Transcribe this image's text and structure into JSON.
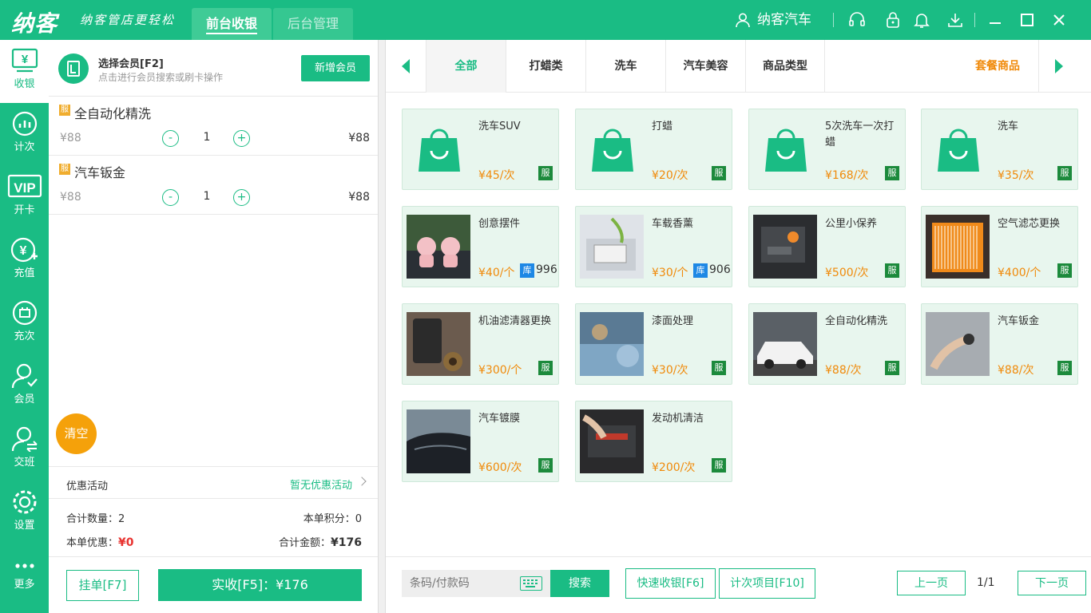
{
  "app": {
    "logo": "纳客",
    "slogan": "纳客管店更轻松",
    "nav_tabs": [
      {
        "label": "前台收银",
        "active": true
      },
      {
        "label": "后台管理",
        "active": false
      }
    ],
    "user_name": "纳客汽车",
    "accent_color": "#1abc84"
  },
  "sidebar": {
    "items": [
      {
        "label": "收银",
        "icon": "cashier-icon",
        "active": true
      },
      {
        "label": "计次",
        "icon": "chart-icon"
      },
      {
        "label": "开卡",
        "icon": "vip-icon"
      },
      {
        "label": "充值",
        "icon": "recharge-icon"
      },
      {
        "label": "充次",
        "icon": "recharge-count-icon"
      },
      {
        "label": "会员",
        "icon": "member-icon"
      },
      {
        "label": "交班",
        "icon": "shift-icon"
      },
      {
        "label": "设置",
        "icon": "settings-icon"
      },
      {
        "label": "更多",
        "icon": "more-icon"
      }
    ]
  },
  "member": {
    "title": "选择会员[F2]",
    "subtitle": "点击进行会员搜索或刷卡操作",
    "add_button": "新增会员"
  },
  "cart": {
    "items": [
      {
        "badge": "服",
        "name": "全自动化精洗",
        "price": "¥88",
        "minus": "-",
        "qty": "1",
        "plus": "+",
        "total": "¥88"
      },
      {
        "badge": "服",
        "name": "汽车钣金",
        "price": "¥88",
        "minus": "-",
        "qty": "1",
        "plus": "+",
        "total": "¥88"
      }
    ],
    "clear_button": "清空",
    "promo_label": "优惠活动",
    "promo_value": "暂无优惠活动",
    "qty_label": "合计数量：",
    "qty_value": "2",
    "points_label": "本单积分：",
    "points_value": "0",
    "discount_label": "本单优惠：",
    "discount_value": "¥0",
    "amount_label": "合计金额：",
    "amount_value": "¥176",
    "hold_button": "挂单[F7]",
    "pay_button": "实收[F5]：¥176"
  },
  "categories": {
    "tabs": [
      "全部",
      "打蜡类",
      "洗车",
      "汽车美容",
      "商品类型"
    ],
    "active": "全部",
    "combo": "套餐商品"
  },
  "products": [
    {
      "name": "洗车SUV",
      "price": "¥45/次",
      "badge": "服",
      "image": "bag"
    },
    {
      "name": "打蜡",
      "price": "¥20/次",
      "badge": "服",
      "image": "bag"
    },
    {
      "name": "5次洗车一次打蜡",
      "price": "¥168/次",
      "badge": "服",
      "image": "bag"
    },
    {
      "name": "洗车",
      "price": "¥35/次",
      "badge": "服",
      "image": "bag"
    },
    {
      "name": "创意摆件",
      "price": "¥40/个",
      "stock_badge": "库",
      "stock": "996",
      "image": "photo-pigs"
    },
    {
      "name": "车载香薰",
      "price": "¥30/个",
      "stock_badge": "库",
      "stock": "906",
      "image": "photo-freshener"
    },
    {
      "name": "公里小保养",
      "price": "¥500/次",
      "badge": "服",
      "image": "photo-engine"
    },
    {
      "name": "空气滤芯更换",
      "price": "¥400/个",
      "badge": "服",
      "image": "photo-filter"
    },
    {
      "name": "机油滤清器更换",
      "price": "¥300/个",
      "badge": "服",
      "image": "photo-oil"
    },
    {
      "name": "漆面处理",
      "price": "¥30/次",
      "badge": "服",
      "image": "photo-paint"
    },
    {
      "name": "全自动化精洗",
      "price": "¥88/次",
      "badge": "服",
      "image": "photo-car-white"
    },
    {
      "name": "汽车钣金",
      "price": "¥88/次",
      "badge": "服",
      "image": "photo-dent"
    },
    {
      "name": "汽车镀膜",
      "price": "¥600/次",
      "badge": "服",
      "image": "photo-car-black"
    },
    {
      "name": "发动机清洁",
      "price": "¥200/次",
      "badge": "服",
      "image": "photo-engine-clean"
    }
  ],
  "bottom": {
    "search_placeholder": "条码/付款码",
    "search_button": "搜索",
    "quick_pay_button": "快速收银[F6]",
    "count_items_button": "计次项目[F10]",
    "prev_page": "上一页",
    "page_indicator": "1/1",
    "next_page": "下一页"
  }
}
